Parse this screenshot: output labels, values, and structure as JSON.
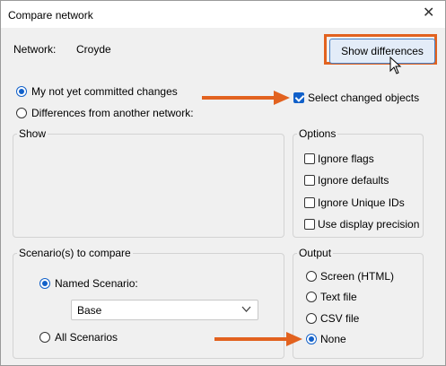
{
  "window": {
    "title": "Compare network",
    "close_glyph": "✕"
  },
  "network": {
    "label": "Network:",
    "value": "Croyde"
  },
  "show_differences_button": {
    "label": "Show differences"
  },
  "mode_options": [
    {
      "label": "My not yet committed changes",
      "selected": true
    },
    {
      "label": "Differences from another network:",
      "selected": false
    }
  ],
  "select_changed": {
    "label": "Select changed objects",
    "checked": true
  },
  "show_group": {
    "title": "Show"
  },
  "options_group": {
    "title": "Options",
    "items": [
      {
        "label": "Ignore flags",
        "checked": false
      },
      {
        "label": "Ignore defaults",
        "checked": false
      },
      {
        "label": "Ignore Unique IDs",
        "checked": false
      },
      {
        "label": "Use display precision",
        "checked": false
      }
    ]
  },
  "scenarios_group": {
    "title": "Scenario(s) to compare",
    "named_label": "Named Scenario:",
    "named_selected": true,
    "dropdown_value": "Base",
    "all_label": "All Scenarios",
    "all_selected": false
  },
  "output_group": {
    "title": "Output",
    "items": [
      {
        "label": "Screen (HTML)",
        "selected": false
      },
      {
        "label": "Text file",
        "selected": false
      },
      {
        "label": "CSV file",
        "selected": false
      },
      {
        "label": "None",
        "selected": true
      }
    ]
  },
  "colors": {
    "highlight": "#e2621f",
    "accent": "#1160c9"
  },
  "icons": {
    "close": "close-icon",
    "chevron": "chevron-down-icon",
    "cursor": "mouse-cursor-icon",
    "arrow": "annotation-arrow-icon"
  }
}
